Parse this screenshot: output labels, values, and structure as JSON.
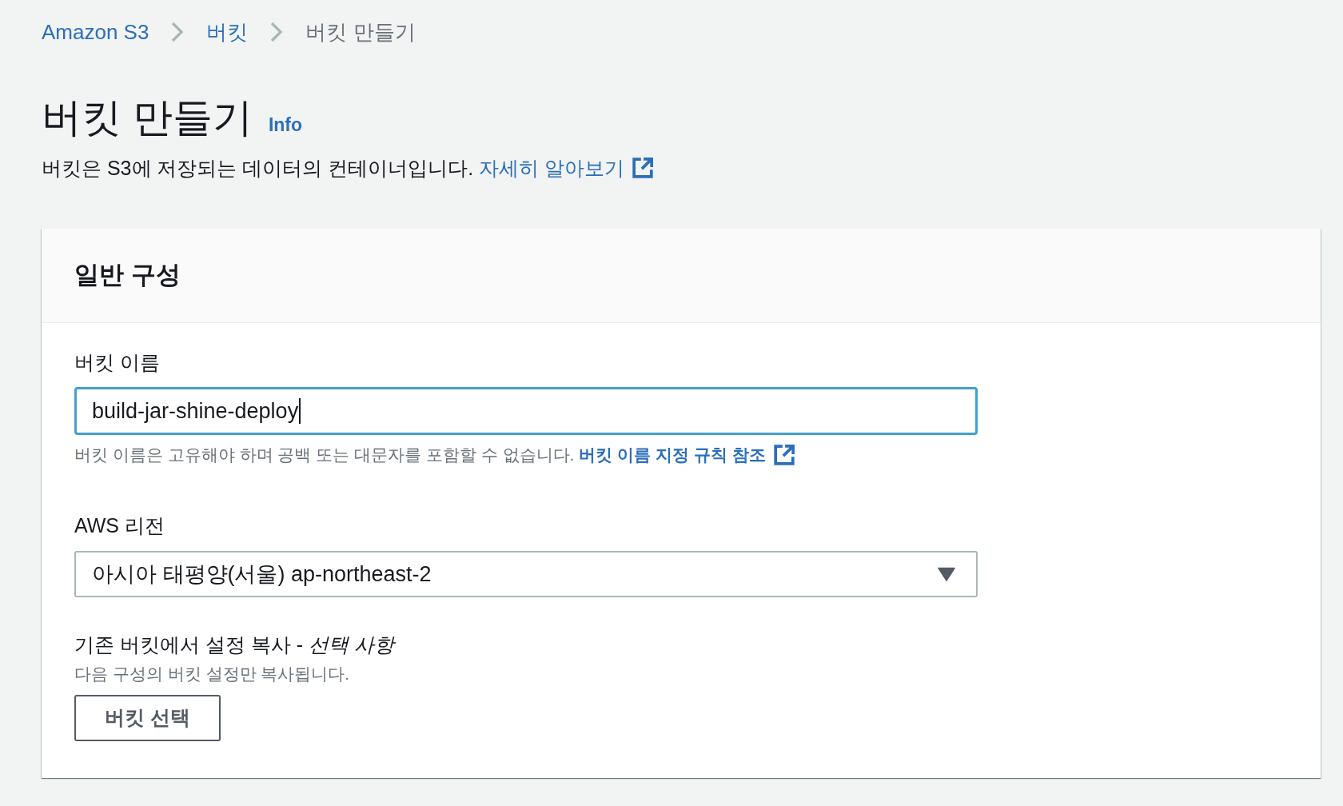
{
  "breadcrumb": [
    {
      "label": "Amazon S3",
      "kind": "link"
    },
    {
      "label": "버킷",
      "kind": "link"
    },
    {
      "label": "버킷 만들기",
      "kind": "current"
    }
  ],
  "header": {
    "title": "버킷 만들기",
    "info_link": "Info",
    "description": "버킷은 S3에 저장되는 데이터의 컨테이너입니다.",
    "learn_more_link": "자세히 알아보기"
  },
  "panel": {
    "title": "일반 구성",
    "fields": [
      {
        "kind": "text",
        "label": "버킷 이름",
        "value": "build-jar-shine-deploy",
        "focused": true,
        "hint": "버킷 이름은 고유해야 하며 공백 또는 대문자를 포함할 수 없습니다.",
        "hint_link": "버킷 이름 지정 규칙 참조"
      },
      {
        "kind": "select",
        "label": "AWS 리전",
        "value": "아시아 태평양(서울) ap-northeast-2"
      },
      {
        "kind": "button",
        "label": "기존 버킷에서 설정 복사 - *선택 사항*",
        "description": "다음 구성의 버킷 설정만 복사됩니다.",
        "button": "버킷 선택"
      }
    ]
  }
}
